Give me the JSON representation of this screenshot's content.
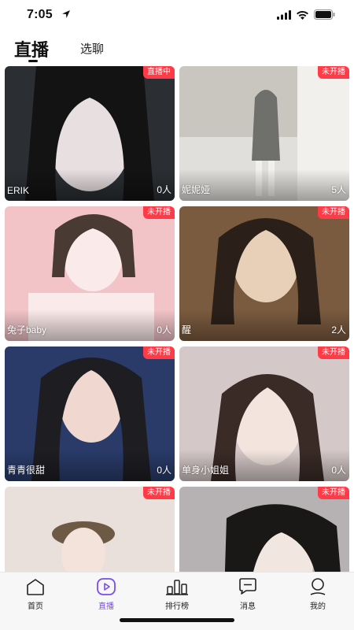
{
  "status_bar": {
    "time": "7:05",
    "icons": [
      "location-arrow-icon",
      "signal-icon",
      "wifi-icon",
      "battery-icon"
    ]
  },
  "header": {
    "tabs": [
      {
        "label": "直播",
        "active": true
      },
      {
        "label": "选聊",
        "active": false
      }
    ]
  },
  "cards": [
    {
      "badge": "直播中",
      "name": "ERIK",
      "count": "0人",
      "palette": [
        "#2b2f33",
        "#e7dfe0",
        "#131313"
      ]
    },
    {
      "badge": "未开播",
      "name": "妮妮娅",
      "count": "5人",
      "palette": [
        "#c9c6c0",
        "#f2f0ec",
        "#6f6f6b"
      ]
    },
    {
      "badge": "未开播",
      "name": "兔子baby",
      "count": "0人",
      "palette": [
        "#f2c4c8",
        "#fbeaea",
        "#4a3a34"
      ]
    },
    {
      "badge": "未开播",
      "name": "醒",
      "count": "2人",
      "palette": [
        "#7b5b3f",
        "#e8d0b8",
        "#2a2019"
      ]
    },
    {
      "badge": "未开播",
      "name": "青青很甜",
      "count": "0人",
      "palette": [
        "#2a3b6a",
        "#f0d7cf",
        "#1e1d22"
      ]
    },
    {
      "badge": "未开播",
      "name": "单身小姐姐",
      "count": "0人",
      "palette": [
        "#d5c8c8",
        "#f3e4de",
        "#3a2b26"
      ]
    },
    {
      "badge": "未开播",
      "name": "",
      "count": "",
      "palette": [
        "#e9e0dc",
        "#f4e3da",
        "#6e5a44"
      ]
    },
    {
      "badge": "未开播",
      "name": "",
      "count": "",
      "palette": [
        "#b6b1b2",
        "#f2e6e0",
        "#1a1717"
      ]
    }
  ],
  "bottom_nav": {
    "items": [
      {
        "label": "首页",
        "icon": "home-icon",
        "active": false
      },
      {
        "label": "直播",
        "icon": "live-play-icon",
        "active": true
      },
      {
        "label": "排行榜",
        "icon": "ranking-icon",
        "active": false
      },
      {
        "label": "消息",
        "icon": "message-icon",
        "active": false
      },
      {
        "label": "我的",
        "icon": "profile-icon",
        "active": false
      }
    ],
    "active_color": "#7a4cf0"
  },
  "colors": {
    "badge": "#ff3b48",
    "accent": "#7a4cf0"
  }
}
